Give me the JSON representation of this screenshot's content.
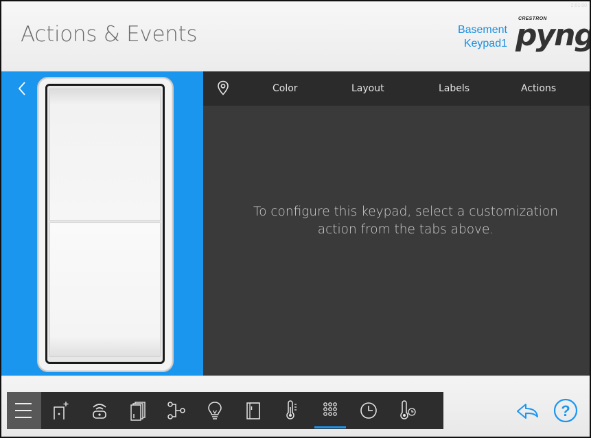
{
  "header": {
    "title": "Actions & Events",
    "room_line1": "Basement",
    "room_line2": "Keypad1",
    "logo_small": "CRESTRON",
    "logo_big": "pyng",
    "corner_text": "2:01:00"
  },
  "tabs": [
    {
      "label": "Color"
    },
    {
      "label": "Layout"
    },
    {
      "label": "Labels"
    },
    {
      "label": "Actions"
    }
  ],
  "content": {
    "message_line1": "To configure this keypad, select a customization",
    "message_line2": "action from the tabs above."
  },
  "toolbar": {
    "items": [
      {
        "icon": "menu-icon"
      },
      {
        "icon": "add-device-icon"
      },
      {
        "icon": "remote-icon"
      },
      {
        "icon": "shades-icon"
      },
      {
        "icon": "sequence-icon"
      },
      {
        "icon": "lightbulb-icon"
      },
      {
        "icon": "door-icon"
      },
      {
        "icon": "thermometer-icon"
      },
      {
        "icon": "keypad-icon",
        "active": true
      },
      {
        "icon": "clock-icon"
      },
      {
        "icon": "temperature-sensor-icon"
      }
    ]
  },
  "colors": {
    "accent": "#1b96ef",
    "dark_panel": "#3a3a3a",
    "tab_bar": "#2b2b2b"
  }
}
